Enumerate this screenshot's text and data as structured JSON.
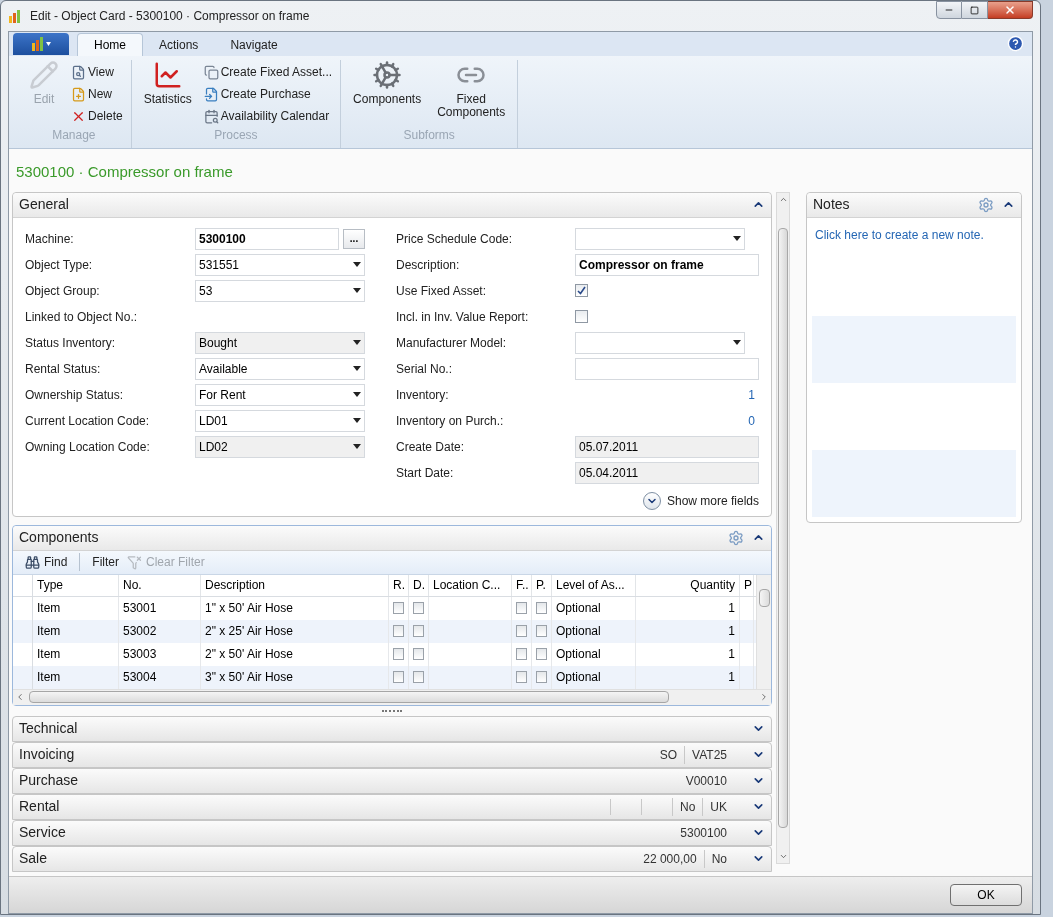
{
  "window": {
    "title": "Edit - Object Card - 5300100 · Compressor on frame"
  },
  "ribbon": {
    "tabs": [
      {
        "label": "Home",
        "selected": true
      },
      {
        "label": "Actions",
        "selected": false
      },
      {
        "label": "Navigate",
        "selected": false
      }
    ],
    "groups": [
      {
        "label": "Manage",
        "actions": [
          {
            "label": "Edit",
            "kind": "large",
            "disabled": true
          },
          {
            "label": "View",
            "kind": "small",
            "disabled": false
          },
          {
            "label": "New",
            "kind": "small",
            "disabled": false
          },
          {
            "label": "Delete",
            "kind": "small",
            "disabled": false
          }
        ]
      },
      {
        "label": "Process",
        "actions": [
          {
            "label": "Statistics",
            "kind": "large",
            "disabled": false
          },
          {
            "label": "Create Fixed Asset...",
            "kind": "small",
            "disabled": false
          },
          {
            "label": "Create Purchase",
            "kind": "small",
            "disabled": false
          },
          {
            "label": "Availability Calendar",
            "kind": "small",
            "disabled": false
          }
        ]
      },
      {
        "label": "Subforms",
        "actions": [
          {
            "label": "Components",
            "kind": "large",
            "disabled": false
          },
          {
            "label": "Fixed Components",
            "kind": "large",
            "disabled": false
          }
        ]
      }
    ]
  },
  "page_title": "5300100 · Compressor on frame",
  "general": {
    "title": "General",
    "show_more": "Show more fields",
    "left_fields": [
      {
        "label": "Machine:",
        "kind": "lookup",
        "value": "5300100",
        "button": "...",
        "bold": true,
        "disabled": false
      },
      {
        "label": "Object Type:",
        "kind": "dropdown",
        "value": "531551",
        "bold": false,
        "disabled": false
      },
      {
        "label": "Object Group:",
        "kind": "dropdown",
        "value": "53",
        "bold": false,
        "disabled": false
      },
      {
        "label": "Linked to Object No.:",
        "kind": "none"
      },
      {
        "label": "Status Inventory:",
        "kind": "dropdown",
        "value": "Bought",
        "bold": false,
        "disabled": true
      },
      {
        "label": "Rental Status:",
        "kind": "dropdown",
        "value": "Available",
        "bold": false,
        "disabled": false
      },
      {
        "label": "Ownership Status:",
        "kind": "dropdown",
        "value": "For Rent",
        "bold": false,
        "disabled": false
      },
      {
        "label": "Current Location Code:",
        "kind": "dropdown",
        "value": "LD01",
        "bold": false,
        "disabled": false
      },
      {
        "label": "Owning Location Code:",
        "kind": "dropdown",
        "value": "LD02",
        "bold": false,
        "disabled": true
      }
    ],
    "right_fields": [
      {
        "label": "Price Schedule Code:",
        "kind": "dropdown",
        "disabled": false
      },
      {
        "label": "Description:",
        "kind": "text",
        "value": "Compressor on frame",
        "bold": true,
        "disabled": false
      },
      {
        "label": "Use Fixed Asset:",
        "kind": "checkbox",
        "checked": true
      },
      {
        "label": "Incl. in Inv. Value Report:",
        "kind": "checkbox",
        "checked": false
      },
      {
        "label": "Manufacturer Model:",
        "kind": "dropdown",
        "disabled": false
      },
      {
        "label": "Serial No.:",
        "kind": "text",
        "disabled": false
      },
      {
        "label": "Inventory:",
        "kind": "number",
        "value": "1"
      },
      {
        "label": "Inventory on Purch.:",
        "kind": "number",
        "value": "0"
      },
      {
        "label": "Create Date:",
        "kind": "text",
        "value": "05.07.2011",
        "bold": false,
        "disabled": true
      },
      {
        "label": "Start Date:",
        "kind": "text",
        "value": "05.04.2011",
        "bold": false,
        "disabled": true
      }
    ]
  },
  "components": {
    "title": "Components",
    "toolbar": [
      {
        "label": "Find",
        "disabled": false
      },
      {
        "label": "Filter",
        "disabled": false
      },
      {
        "label": "Clear Filter",
        "disabled": true
      }
    ],
    "columns": [
      {
        "label": "Type",
        "kind": "text"
      },
      {
        "label": "No.",
        "kind": "text"
      },
      {
        "label": "Description",
        "kind": "text"
      },
      {
        "label": "R.",
        "kind": "check"
      },
      {
        "label": "D.",
        "kind": "check"
      },
      {
        "label": "Location C...",
        "kind": "text"
      },
      {
        "label": "F..",
        "kind": "check"
      },
      {
        "label": "P.",
        "kind": "check"
      },
      {
        "label": "Level of As...",
        "kind": "text"
      },
      {
        "label": "Quantity",
        "kind": "number"
      },
      {
        "label": "P",
        "kind": "text"
      }
    ],
    "rows": [
      {
        "cells": [
          "Item",
          "53001",
          "1\" x 50' Air Hose",
          false,
          false,
          null,
          false,
          false,
          "Optional",
          "1"
        ]
      },
      {
        "cells": [
          "Item",
          "53002",
          "2\" x 25' Air Hose",
          false,
          false,
          null,
          false,
          false,
          "Optional",
          "1"
        ]
      },
      {
        "cells": [
          "Item",
          "53003",
          "2\" x 50' Air Hose",
          false,
          false,
          null,
          false,
          false,
          "Optional",
          "1"
        ]
      },
      {
        "cells": [
          "Item",
          "53004",
          "3\" x 50' Air Hose",
          false,
          false,
          null,
          false,
          false,
          "Optional",
          "1"
        ]
      }
    ]
  },
  "fasttabs": [
    {
      "title": "Technical"
    },
    {
      "title": "Invoicing",
      "summary": [
        {
          "kind": "value",
          "text": "SO"
        },
        {
          "kind": "value",
          "text": "VAT25"
        }
      ]
    },
    {
      "title": "Purchase",
      "summary": [
        {
          "kind": "value",
          "text": "V00010"
        }
      ]
    },
    {
      "title": "Rental",
      "summary": [
        {
          "kind": "blank"
        },
        {
          "kind": "blank"
        },
        {
          "kind": "value",
          "text": "No"
        },
        {
          "kind": "value",
          "text": "UK"
        }
      ]
    },
    {
      "title": "Service",
      "summary": [
        {
          "kind": "value",
          "text": "5300100"
        }
      ]
    },
    {
      "title": "Sale",
      "summary": [
        {
          "kind": "value",
          "text": "22 000,00"
        },
        {
          "kind": "value",
          "text": "No"
        }
      ]
    }
  ],
  "notes": {
    "title": "Notes",
    "link": "Click here to create a new note."
  },
  "footer": {
    "ok": "OK"
  }
}
